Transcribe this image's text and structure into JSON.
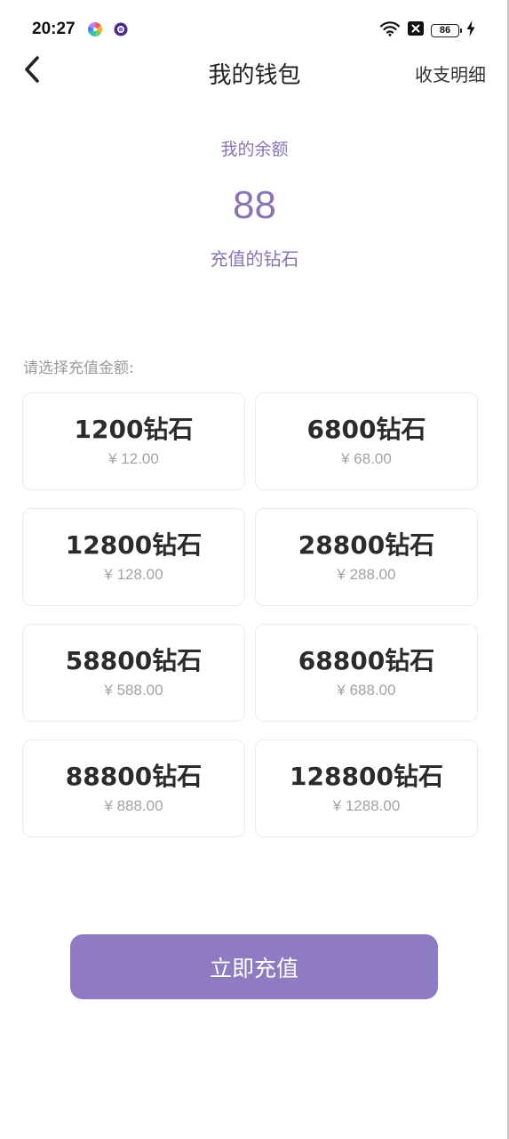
{
  "status_bar": {
    "time": "20:27",
    "battery_level": "86",
    "icons": [
      "pinwheel-app-icon",
      "purple-app-icon",
      "wifi-icon",
      "notification-x-icon",
      "battery-icon",
      "charging-bolt-icon"
    ]
  },
  "nav": {
    "title": "我的钱包",
    "right_action": "收支明细",
    "back_icon": "chevron-left-icon"
  },
  "balance": {
    "label": "我的余额",
    "amount": "88",
    "unit_label": "充值的钻石"
  },
  "section_label": "请选择充值金额:",
  "packages": [
    {
      "amount": "1200钻石",
      "price": "¥ 12.00"
    },
    {
      "amount": "6800钻石",
      "price": "¥ 68.00"
    },
    {
      "amount": "12800钻石",
      "price": "¥ 128.00"
    },
    {
      "amount": "28800钻石",
      "price": "¥ 288.00"
    },
    {
      "amount": "58800钻石",
      "price": "¥ 588.00"
    },
    {
      "amount": "68800钻石",
      "price": "¥ 688.00"
    },
    {
      "amount": "88800钻石",
      "price": "¥ 888.00"
    },
    {
      "amount": "128800钻石",
      "price": "¥ 1288.00"
    }
  ],
  "recharge_button": "立即充值",
  "colors": {
    "accent": "#8e7bc1",
    "balance_text": "#8a74b3",
    "card_border": "#ececec",
    "price_text": "#a3a3a3"
  }
}
